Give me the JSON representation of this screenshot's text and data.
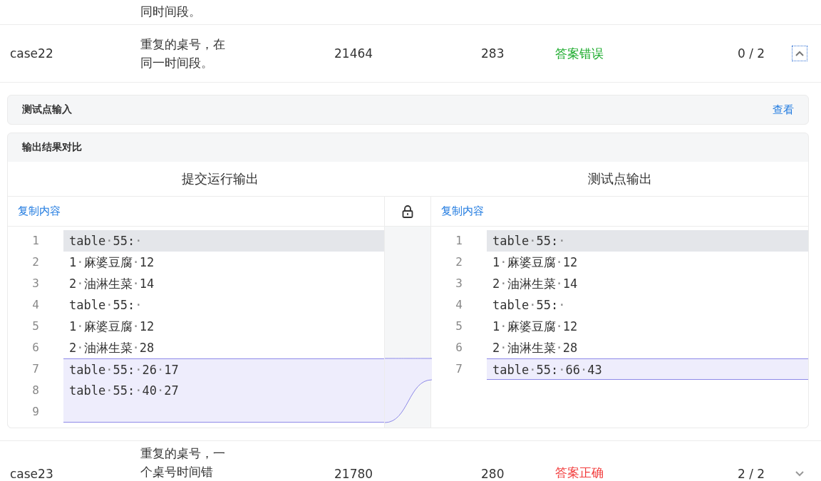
{
  "rows": [
    {
      "description": "同时间段。"
    },
    {
      "case": "case22",
      "description": "重复的桌号，在同一时间段。",
      "time": "21464",
      "memory": "283",
      "result": "答案错误",
      "color": "#1aab2b",
      "score": "0 / 2",
      "expanded": true
    },
    {
      "case": "case23",
      "description": "重复的桌号，一个桌号时间错",
      "time": "21780",
      "memory": "280",
      "result": "答案正确",
      "color": "#f23c3c",
      "score": "2 / 2",
      "expanded": false
    }
  ],
  "detail": {
    "input_box": {
      "title": "测试点输入",
      "link": "查看"
    },
    "compare_box": {
      "title": "输出结果对比",
      "left": {
        "heading": "提交运行输出",
        "copy": "复制内容",
        "lines": [
          {
            "number": "1",
            "text": "table·55:·",
            "current": true,
            "changed": false
          },
          {
            "number": "2",
            "text": "1·麻婆豆腐·12",
            "current": false,
            "changed": false
          },
          {
            "number": "3",
            "text": "2·油淋生菜·14",
            "current": false,
            "changed": false
          },
          {
            "number": "4",
            "text": "table·55:·",
            "current": false,
            "changed": false
          },
          {
            "number": "5",
            "text": "1·麻婆豆腐·12",
            "current": false,
            "changed": false
          },
          {
            "number": "6",
            "text": "2·油淋生菜·28",
            "current": false,
            "changed": false
          },
          {
            "number": "7",
            "text": "table·55:·26·17",
            "current": false,
            "changed": true
          },
          {
            "number": "8",
            "text": "table·55:·40·27",
            "current": false,
            "changed": true
          },
          {
            "number": "9",
            "current": false,
            "changed": true
          }
        ]
      },
      "right": {
        "heading": "测试点输出",
        "copy": "复制内容",
        "lines": [
          {
            "number": "1",
            "text": "table·55:·",
            "current": true,
            "changed": false
          },
          {
            "number": "2",
            "text": "1·麻婆豆腐·12",
            "current": false,
            "changed": false
          },
          {
            "number": "3",
            "text": "2·油淋生菜·14",
            "current": false,
            "changed": false
          },
          {
            "number": "4",
            "text": "table·55:·",
            "current": false,
            "changed": false
          },
          {
            "number": "5",
            "text": "1·麻婆豆腐·12",
            "current": false,
            "changed": false
          },
          {
            "number": "6",
            "text": "2·油淋生菜·28",
            "current": false,
            "changed": false
          },
          {
            "number": "7",
            "text": "table·55:·66·43",
            "current": false,
            "changed": true
          }
        ]
      },
      "scroll_locked": true
    }
  }
}
